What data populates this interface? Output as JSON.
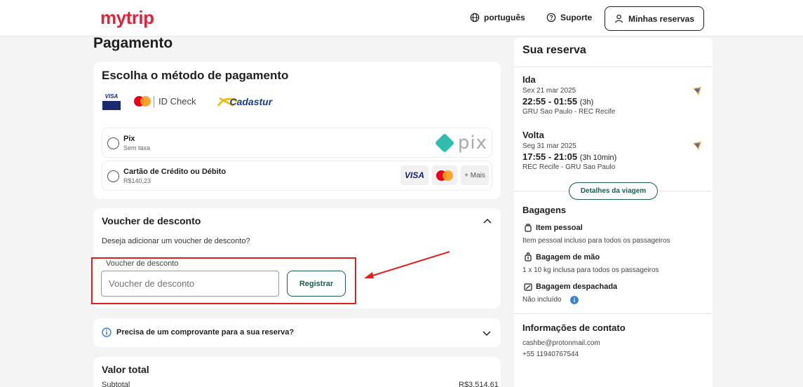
{
  "header": {
    "logo": "mytrip",
    "language": "português",
    "support": "Suporte",
    "reservations": "Minhas reservas"
  },
  "page": {
    "title": "Pagamento"
  },
  "payment": {
    "title": "Escolha o método de pagamento",
    "logos": {
      "visa_small": "VISA",
      "idcheck": "ID Check",
      "cadastur": "Cadastur"
    },
    "options": [
      {
        "title": "Pix",
        "subtitle": "Sem taxa",
        "logo": "pix"
      },
      {
        "title": "Cartão de Crédito ou Débito",
        "subtitle": "R$140,23",
        "brands": [
          "VISA",
          "mastercard",
          "+ Mais"
        ]
      }
    ]
  },
  "voucher": {
    "title": "Voucher de desconto",
    "question": "Deseja adicionar um voucher de desconto?",
    "field_label": "Voucher de desconto",
    "placeholder": "Voucher de desconto",
    "value": "",
    "button": "Registrar"
  },
  "receipt": {
    "text": "Precisa de um comprovante para a sua reserva?"
  },
  "total": {
    "title": "Valor total",
    "subtotal_label": "Subtotal",
    "subtotal_value": "R$3.514,61"
  },
  "reservation": {
    "title": "Sua reserva",
    "outbound": {
      "label": "Ida",
      "date": "Sex 21 mar 2025",
      "times": "22:55 - 01:55",
      "duration": "(3h)",
      "route": "GRU Sao Paulo - REC Recife"
    },
    "inbound": {
      "label": "Volta",
      "date": "Seg 31 mar 2025",
      "times": "17:55 - 21:05",
      "duration": "(3h 10min)",
      "route": "REC Recife - GRU Sao Paulo"
    },
    "details_button": "Detalhes da viagem",
    "baggage": {
      "title": "Bagagens",
      "items": [
        {
          "name": "Item pessoal",
          "desc": "Item pessoal incluso para todos os passageiros"
        },
        {
          "name": "Bagagem de mão",
          "desc": "1 x 10 kg inclusa para todos os passageiros"
        },
        {
          "name": "Bagagem despachada",
          "desc": "Não incluído"
        }
      ]
    },
    "contact": {
      "title": "Informações de contato",
      "email": "cashbe@protonmail.com",
      "phone": "+55 11940767544"
    }
  },
  "colors": {
    "brand": "#e0223a",
    "accent": "#1a5c52",
    "highlight": "#e41d1d",
    "pix": "#32bcad"
  }
}
